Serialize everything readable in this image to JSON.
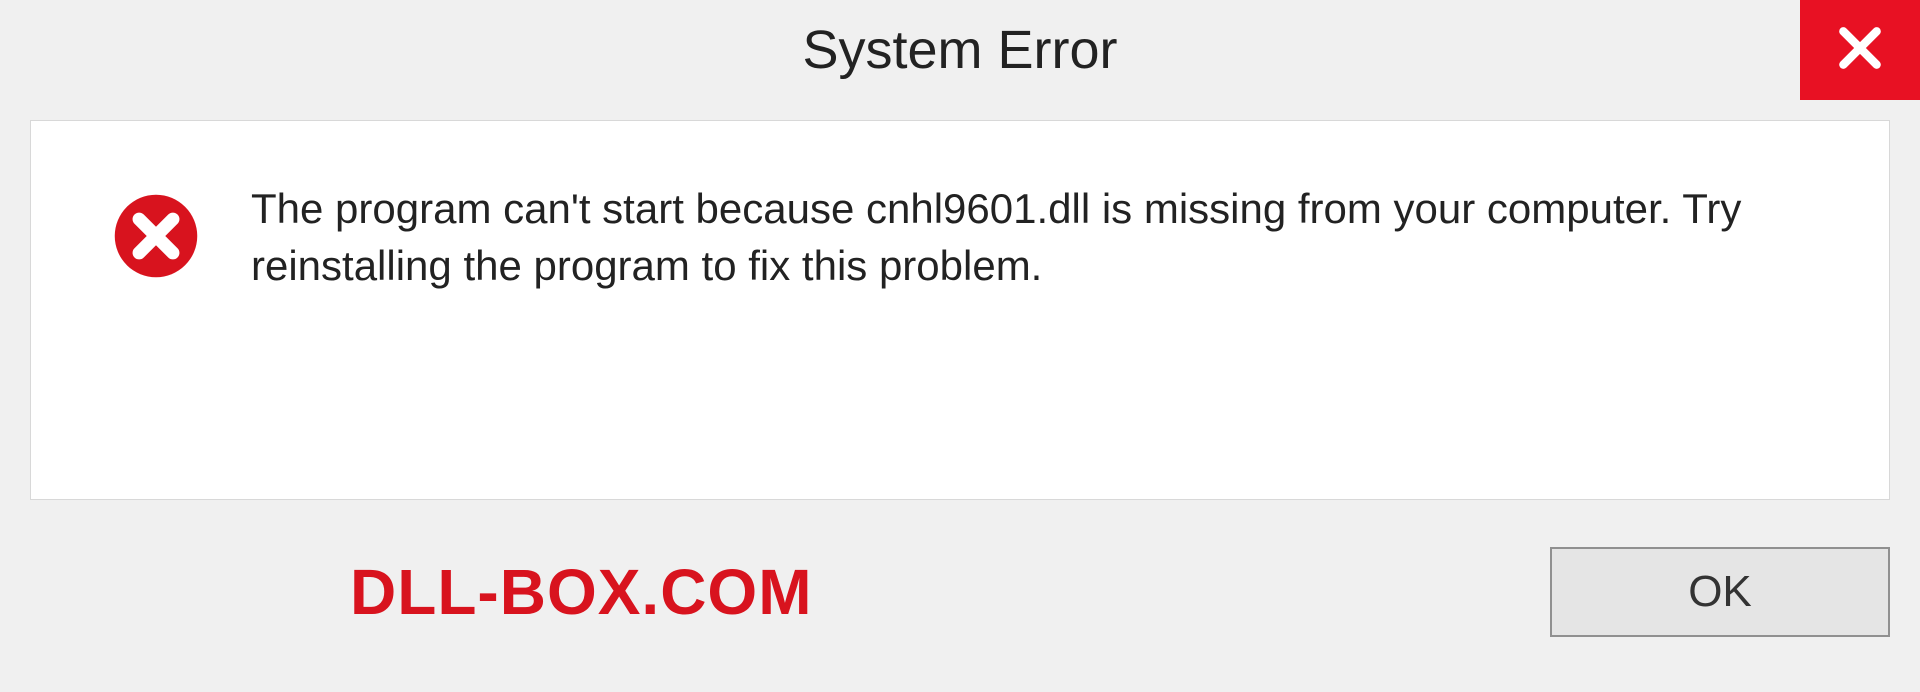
{
  "dialog": {
    "title": "System Error",
    "message": "The program can't start because cnhl9601.dll is missing from your computer. Try reinstalling the program to fix this problem.",
    "ok_label": "OK"
  },
  "watermark": "DLL-BOX.COM",
  "colors": {
    "close_bg": "#e81123",
    "error_icon": "#d8131e",
    "watermark": "#d8131e"
  }
}
